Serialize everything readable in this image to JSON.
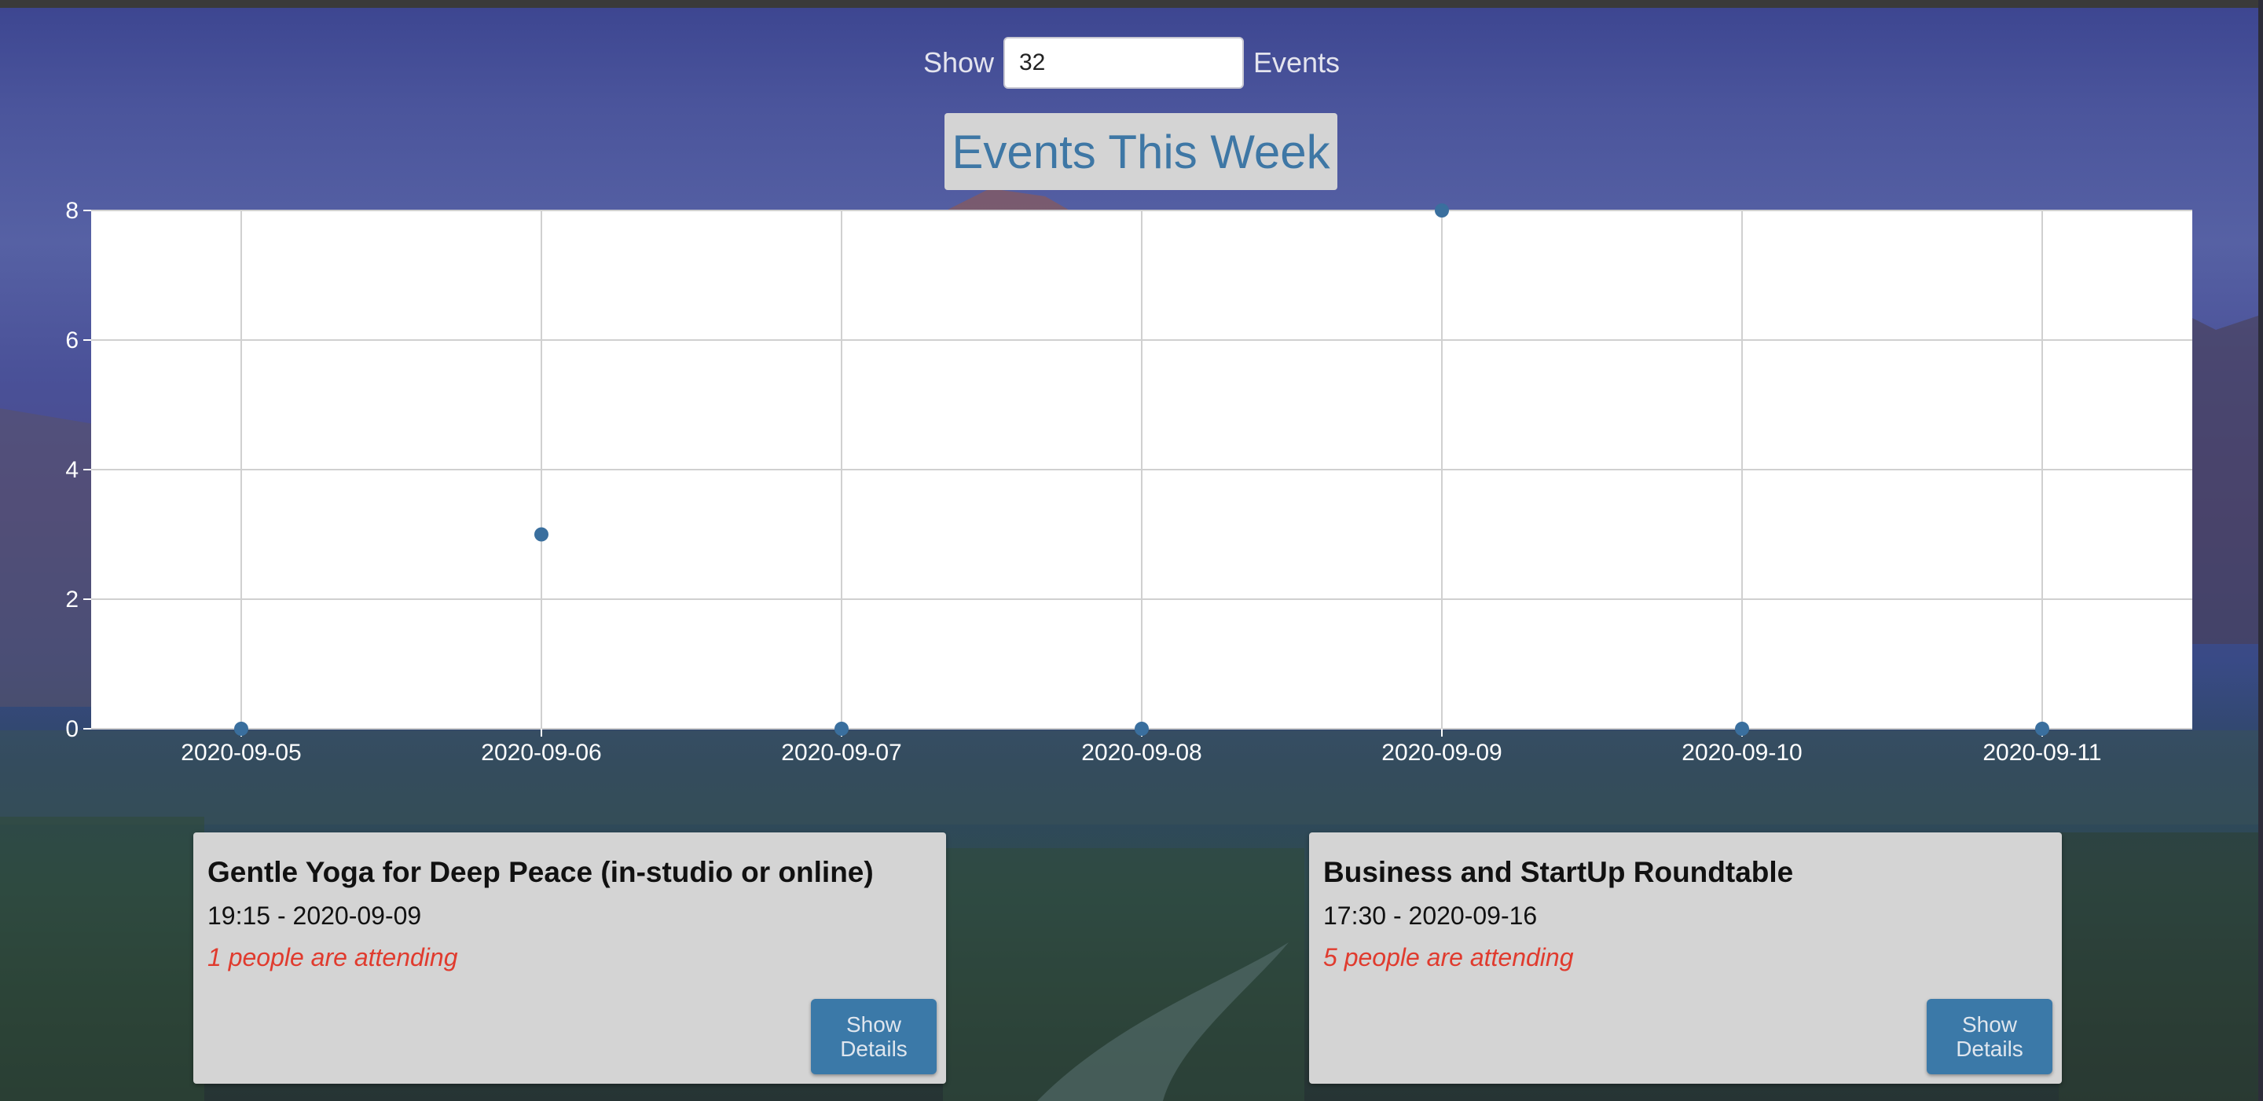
{
  "controls": {
    "show_label": "Show",
    "count_value": "32",
    "events_label": "Events"
  },
  "chart_title": "Events This Week",
  "chart_data": {
    "type": "scatter",
    "title": "Events This Week",
    "xlabel": "",
    "ylabel": "",
    "categories": [
      "2020-09-05",
      "2020-09-06",
      "2020-09-07",
      "2020-09-08",
      "2020-09-09",
      "2020-09-10",
      "2020-09-11"
    ],
    "values": [
      0,
      3,
      0,
      0,
      8,
      0,
      0
    ],
    "ylim": [
      0,
      8
    ],
    "yticks": [
      "0",
      "2",
      "4",
      "6",
      "8"
    ],
    "grid": true,
    "point_color": "#3a6f9e"
  },
  "events": [
    {
      "name": "Gentle Yoga for Deep Peace (in-studio or online)",
      "time": "19:15 - 2020-09-09",
      "attending": "1 people are attending",
      "button_label": "Show\nDetails"
    },
    {
      "name": "Business and StartUp Roundtable",
      "time": "17:30 - 2020-09-16",
      "attending": "5 people are attending",
      "button_label": "Show\nDetails"
    }
  ],
  "colors": {
    "accent": "#3b79a8",
    "attending": "#e03b2e",
    "card_bg": "#d4d4d4"
  }
}
